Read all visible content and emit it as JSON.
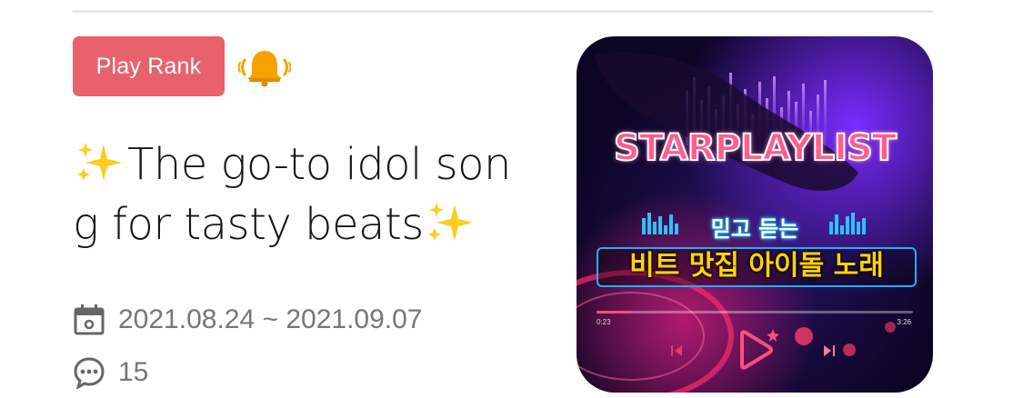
{
  "badge": {
    "label": "Play Rank"
  },
  "title": {
    "line1": "The go-to idol son",
    "line2": "g for tasty beats"
  },
  "period": {
    "text": "2021.08.24 ~ 2021.09.07"
  },
  "comments": {
    "count": "15"
  },
  "thumbnail": {
    "title": "STARPLAYLIST",
    "line1": "믿고 듣는",
    "line2": "비트 맛집 아이돌 노래",
    "time_elapsed": "0:23",
    "time_total": "3:26",
    "progress": 0.11
  },
  "colors": {
    "badge": "#e8626c",
    "text_muted": "#777777",
    "bell": "#f5a300"
  },
  "icons": [
    "bell-icon",
    "sparkle-icon",
    "calendar-icon",
    "comment-icon",
    "play-icon",
    "prev-icon",
    "next-icon"
  ]
}
